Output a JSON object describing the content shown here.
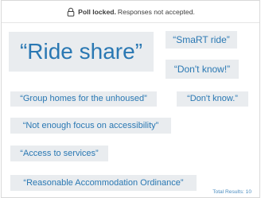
{
  "banner": {
    "title": "Poll locked.",
    "subtitle": "Responses not accepted.",
    "icon": "lock-icon"
  },
  "responses": [
    "“Ride share”",
    "“SmaRT ride”",
    "“Don't know!”",
    "“Group homes for the unhoused”",
    "“Don't know.”",
    "“Not enough focus on accessibility”",
    "“Access to services”",
    "“Reasonable Accommodation Ordinance”"
  ],
  "footer": {
    "total_results": "Total Results: 10"
  },
  "colors": {
    "accent": "#2a78b3",
    "chip_bg": "#e9ecef"
  }
}
